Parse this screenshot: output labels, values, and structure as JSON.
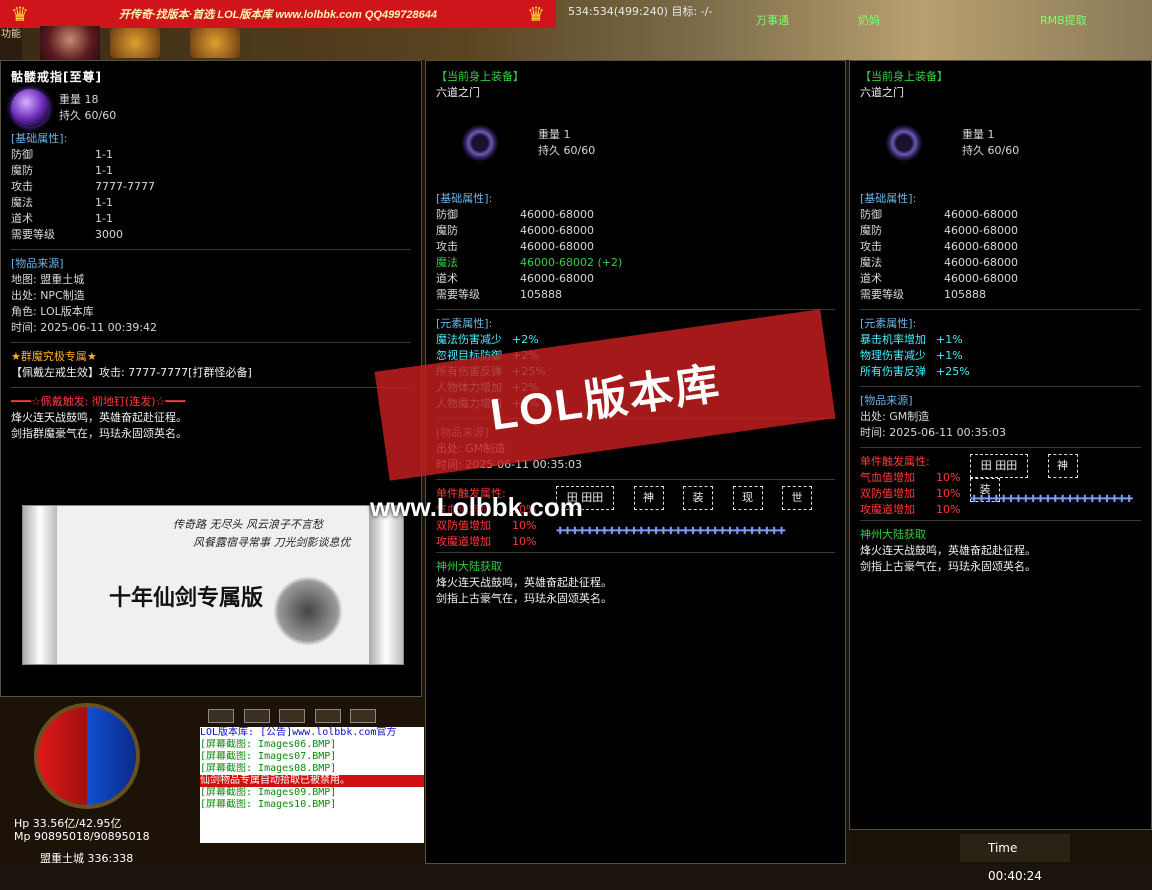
{
  "top": {
    "banner_text": "开传奇·找版本·首选   LOL版本库   www.lolbbk.com QQ499728644",
    "coords": "534:534(499:240) 目标: -/-",
    "func_label": "功能",
    "npc1": "万事通",
    "npc2": "奶妈",
    "npc3": "RMB提取"
  },
  "panel1": {
    "title": "骷髅戒指[至尊]",
    "weight": "重量 18",
    "durability": "持久 60/60",
    "basic_header": "[基础属性]:",
    "basic": [
      {
        "k": "防御",
        "v": "1-1"
      },
      {
        "k": "魔防",
        "v": "1-1"
      },
      {
        "k": "攻击",
        "v": "7777-7777"
      },
      {
        "k": "魔法",
        "v": "1-1"
      },
      {
        "k": "道术",
        "v": "1-1"
      },
      {
        "k": "需要等级",
        "v": "3000"
      }
    ],
    "source_header": "[物品来源]",
    "source": [
      "地图: 盟重土城",
      "出处: NPC制造",
      "角色: LOL版本库",
      "时间: 2025-06-11 00:39:42"
    ],
    "special_header": "★群魔究极专属★",
    "special_line": "【佩戴左戒生效】攻击: 7777-7777[打群怪必备]",
    "trigger_line": "━━━☆佩戴触发: 彻地钉(连发)☆━━━",
    "poem1": "烽火连天战鼓鸣，英雄奋起赴征程。",
    "poem2": "剑指群魔豪气在，玛珐永固颂英名。"
  },
  "scroll": {
    "line1": "传奇路  无尽头  风云浪子不言愁",
    "line2": "风餐露宿寻常事  刀光剑影谈息优",
    "big": "十年仙剑专属版"
  },
  "panel2": {
    "header": "【当前身上装备】",
    "title": "六道之门",
    "weight": "重量 1",
    "durability": "持久 60/60",
    "basic_header": "[基础属性]:",
    "basic": [
      {
        "k": "防御",
        "v": "46000-68000"
      },
      {
        "k": "魔防",
        "v": "46000-68000"
      },
      {
        "k": "攻击",
        "v": "46000-68000"
      },
      {
        "k": "魔法",
        "v": "46000-68002 (+2)"
      },
      {
        "k": "道术",
        "v": "46000-68000"
      },
      {
        "k": "需要等级",
        "v": "105888"
      }
    ],
    "element_header": "[元素属性]:",
    "element": [
      {
        "k": "魔法伤害减少",
        "v": "+2%"
      },
      {
        "k": "忽视目标防御",
        "v": "+2%"
      },
      {
        "k": "所有伤害反弹",
        "v": "+25%"
      },
      {
        "k": "人物体力增加",
        "v": "+2%"
      },
      {
        "k": "人物魔力增加",
        "v": "+1%"
      }
    ],
    "source_header": "[物品来源]",
    "source": [
      "出处: GM制造",
      "时间: 2025-06-11 00:35:03"
    ],
    "set_header": "单件触发属性:",
    "set": [
      {
        "k": "气血值增加",
        "v": "10%"
      },
      {
        "k": "双防值增加",
        "v": "10%"
      },
      {
        "k": "攻魔道增加",
        "v": "10%"
      }
    ],
    "set_boxes": [
      "神",
      "装",
      "现",
      "世"
    ],
    "set_small": "田 田田",
    "shenzhou_header": "神州大陆获取",
    "poem1": "烽火连天战鼓鸣，英雄奋起赴征程。",
    "poem2": "剑指上古豪气在，玛珐永固颂英名。"
  },
  "panel3": {
    "header": "【当前身上装备】",
    "title": "六道之门",
    "weight": "重量 1",
    "durability": "持久 60/60",
    "basic_header": "[基础属性]:",
    "basic": [
      {
        "k": "防御",
        "v": "46000-68000"
      },
      {
        "k": "魔防",
        "v": "46000-68000"
      },
      {
        "k": "攻击",
        "v": "46000-68000"
      },
      {
        "k": "魔法",
        "v": "46000-68000"
      },
      {
        "k": "道术",
        "v": "46000-68000"
      },
      {
        "k": "需要等级",
        "v": "105888"
      }
    ],
    "element_header": "[元素属性]:",
    "element": [
      {
        "k": "暴击机率增加",
        "v": "+1%"
      },
      {
        "k": "物理伤害减少",
        "v": "+1%"
      },
      {
        "k": "所有伤害反弹",
        "v": "+25%"
      }
    ],
    "source_header": "[物品来源]",
    "source": [
      "出处: GM制造",
      "时间: 2025-06-11 00:35:03"
    ],
    "set_header": "单件触发属性:",
    "set": [
      {
        "k": "气血值增加",
        "v": "10%"
      },
      {
        "k": "双防值增加",
        "v": "10%"
      },
      {
        "k": "攻魔道增加",
        "v": "10%"
      }
    ],
    "set_boxes": [
      "神",
      "装"
    ],
    "set_small": "田 田田",
    "shenzhou_header": "神州大陆获取",
    "poem1": "烽火连天战鼓鸣，英雄奋起赴征程。",
    "poem2": "剑指上古豪气在，玛珐永固颂英名。"
  },
  "watermark": {
    "main": "LOL版本库",
    "url": "www.Lolbbk.com"
  },
  "status": {
    "hp": "Hp 33.56亿/42.95亿",
    "mp": "Mp 90895018/90895018",
    "location": "盟重土城 336:338",
    "time": "Time 00:40:24"
  },
  "chat": [
    {
      "text": "LOL版本库: [公告]www.lolbbk.com官方",
      "style": "blue"
    },
    {
      "text": "[屏幕截图: Images06.BMP]",
      "style": ""
    },
    {
      "text": "[屏幕截图: Images07.BMP]",
      "style": ""
    },
    {
      "text": "[屏幕截图: Images08.BMP]",
      "style": ""
    },
    {
      "text": "仙剑物品专属自动拾取已被禁用。",
      "style": "hl"
    },
    {
      "text": "[屏幕截图: Images09.BMP]",
      "style": ""
    },
    {
      "text": "[屏幕截图: Images10.BMP]",
      "style": ""
    }
  ],
  "colors": {
    "banner": "#d0141c",
    "watermark": "#c81e1e",
    "cyan_label": "#6ab4e6",
    "green": "#30d040"
  }
}
